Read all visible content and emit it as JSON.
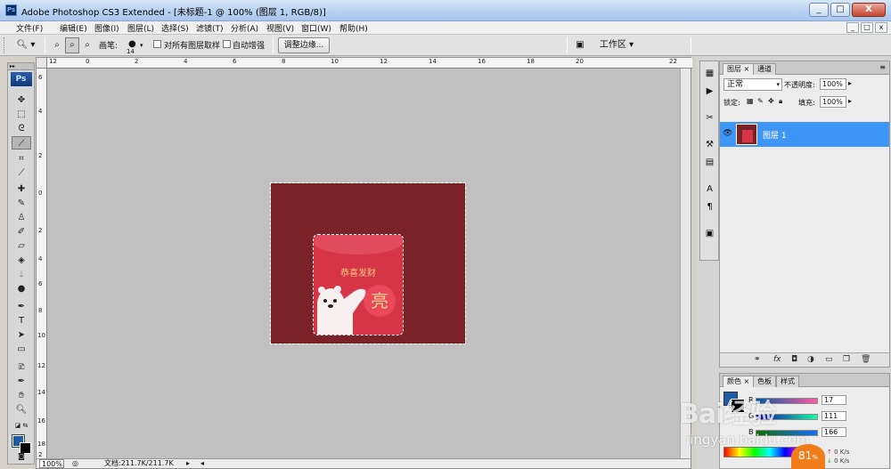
{
  "window": {
    "title": "Adobe Photoshop CS3 Extended - [未标题-1 @ 100% (图层 1, RGB/8)]",
    "app_icon": "Ps",
    "controls": [
      "_",
      "□",
      "X"
    ]
  },
  "menu": [
    "文件(F)",
    "编辑(E)",
    "图像(I)",
    "图层(L)",
    "选择(S)",
    "滤镜(T)",
    "分析(A)",
    "视图(V)",
    "窗口(W)",
    "帮助(H)"
  ],
  "doc_controls": [
    "_",
    "□",
    "x"
  ],
  "options": {
    "brush_label": "画笔:",
    "brush_size": "14",
    "sample_all_layers": "对所有图层取样",
    "auto_enhance": "自动增强",
    "refine_edge": "调整边缘...",
    "workspace": "工作区 ▾"
  },
  "toolbox": {
    "logo": "Ps",
    "collapse": "▸▸"
  },
  "document": {
    "ruler_top": [
      "12",
      "0",
      "2",
      "4",
      "6",
      "8",
      "10",
      "12",
      "14",
      "16",
      "18",
      "20",
      "22"
    ],
    "ruler_left": [
      "6",
      "4",
      "2",
      "0",
      "2",
      "4",
      "6",
      "8",
      "10",
      "12",
      "14",
      "16",
      "18",
      "2"
    ],
    "zoom": "100%",
    "doc_info": "文档:211.7K/211.7K",
    "canvas": {
      "background": "#7a2228",
      "envelope_color": "#d63447",
      "greeting": "恭喜发财",
      "coin_char": "亮"
    }
  },
  "layers_panel": {
    "tabs": [
      "图层 ×",
      "通道"
    ],
    "blend_mode": "正常",
    "opacity_label": "不透明度:",
    "opacity": "100%",
    "lock_label": "锁定:",
    "fill_label": "填充:",
    "fill": "100%",
    "layers": [
      {
        "name": "图层 1",
        "selected": true,
        "visible": true
      }
    ],
    "footer_icons": [
      "link-icon",
      "fx-icon",
      "mask-icon",
      "adjustment-icon",
      "group-icon",
      "new-layer-icon",
      "trash-icon"
    ]
  },
  "color_panel": {
    "tabs": [
      "颜色 ×",
      "色板",
      "样式"
    ],
    "channels": [
      {
        "label": "R",
        "value": "17"
      },
      {
        "label": "G",
        "value": "111"
      },
      {
        "label": "B",
        "value": "166"
      }
    ],
    "foreground": "#1f5aa5",
    "background": "#000000"
  },
  "overlays": {
    "watermark": "Bai经验",
    "watermark_url": "jingyan.baidu.com",
    "speed_value": "81",
    "speed_unit": "%",
    "net_up": "0 K/s",
    "net_down": "0 K/s"
  }
}
